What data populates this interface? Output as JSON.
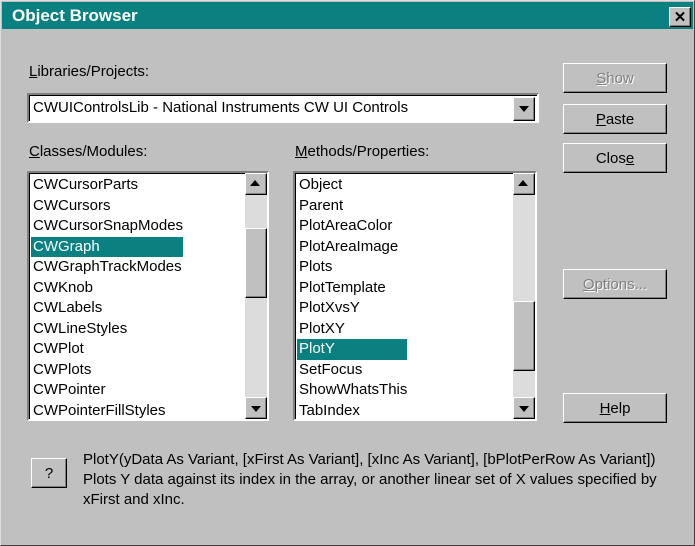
{
  "window": {
    "title": "Object Browser",
    "close_glyph": "✕"
  },
  "libraries": {
    "label_underline": "L",
    "label_rest": "ibraries/Projects:",
    "selected": "CWUIControlsLib - National Instruments CW UI Controls"
  },
  "classes": {
    "label_underline": "C",
    "label_rest": "lasses/Modules:",
    "items": [
      "CWCursorParts",
      "CWCursors",
      "CWCursorSnapModes",
      "CWGraph",
      "CWGraphTrackModes",
      "CWKnob",
      "CWLabels",
      "CWLineStyles",
      "CWPlot",
      "CWPlots",
      "CWPointer",
      "CWPointerFillStyles"
    ],
    "selected_index": 3,
    "scroll_fraction": 0.25
  },
  "methods": {
    "label_underline": "M",
    "label_rest": "ethods/Properties:",
    "items": [
      "Object",
      "Parent",
      "PlotAreaColor",
      "PlotAreaImage",
      "Plots",
      "PlotTemplate",
      "PlotXvsY",
      "PlotXY",
      "PlotY",
      "SetFocus",
      "ShowWhatsThis",
      "TabIndex"
    ],
    "selected_index": 8,
    "scroll_fraction": 0.8
  },
  "buttons": {
    "show": {
      "underline": "S",
      "rest": "how",
      "enabled": false
    },
    "paste": {
      "underline": "P",
      "rest": "aste",
      "enabled": true
    },
    "close": {
      "pre": "Clos",
      "underline": "e",
      "enabled": true
    },
    "options": {
      "underline": "O",
      "rest": "ptions...",
      "enabled": false
    },
    "help": {
      "underline": "H",
      "rest": "elp",
      "enabled": true
    },
    "question": "?"
  },
  "description": {
    "signature": "PlotY(yData As Variant, [xFirst As Variant], [xInc As Variant], [bPlotPerRow As Variant])",
    "text": "Plots Y data against its index in the array, or another linear set of X values specified by xFirst and xInc."
  },
  "colors": {
    "titlebar": "#0b8080",
    "selection": "#0b8080",
    "face": "#c0c0c0"
  }
}
